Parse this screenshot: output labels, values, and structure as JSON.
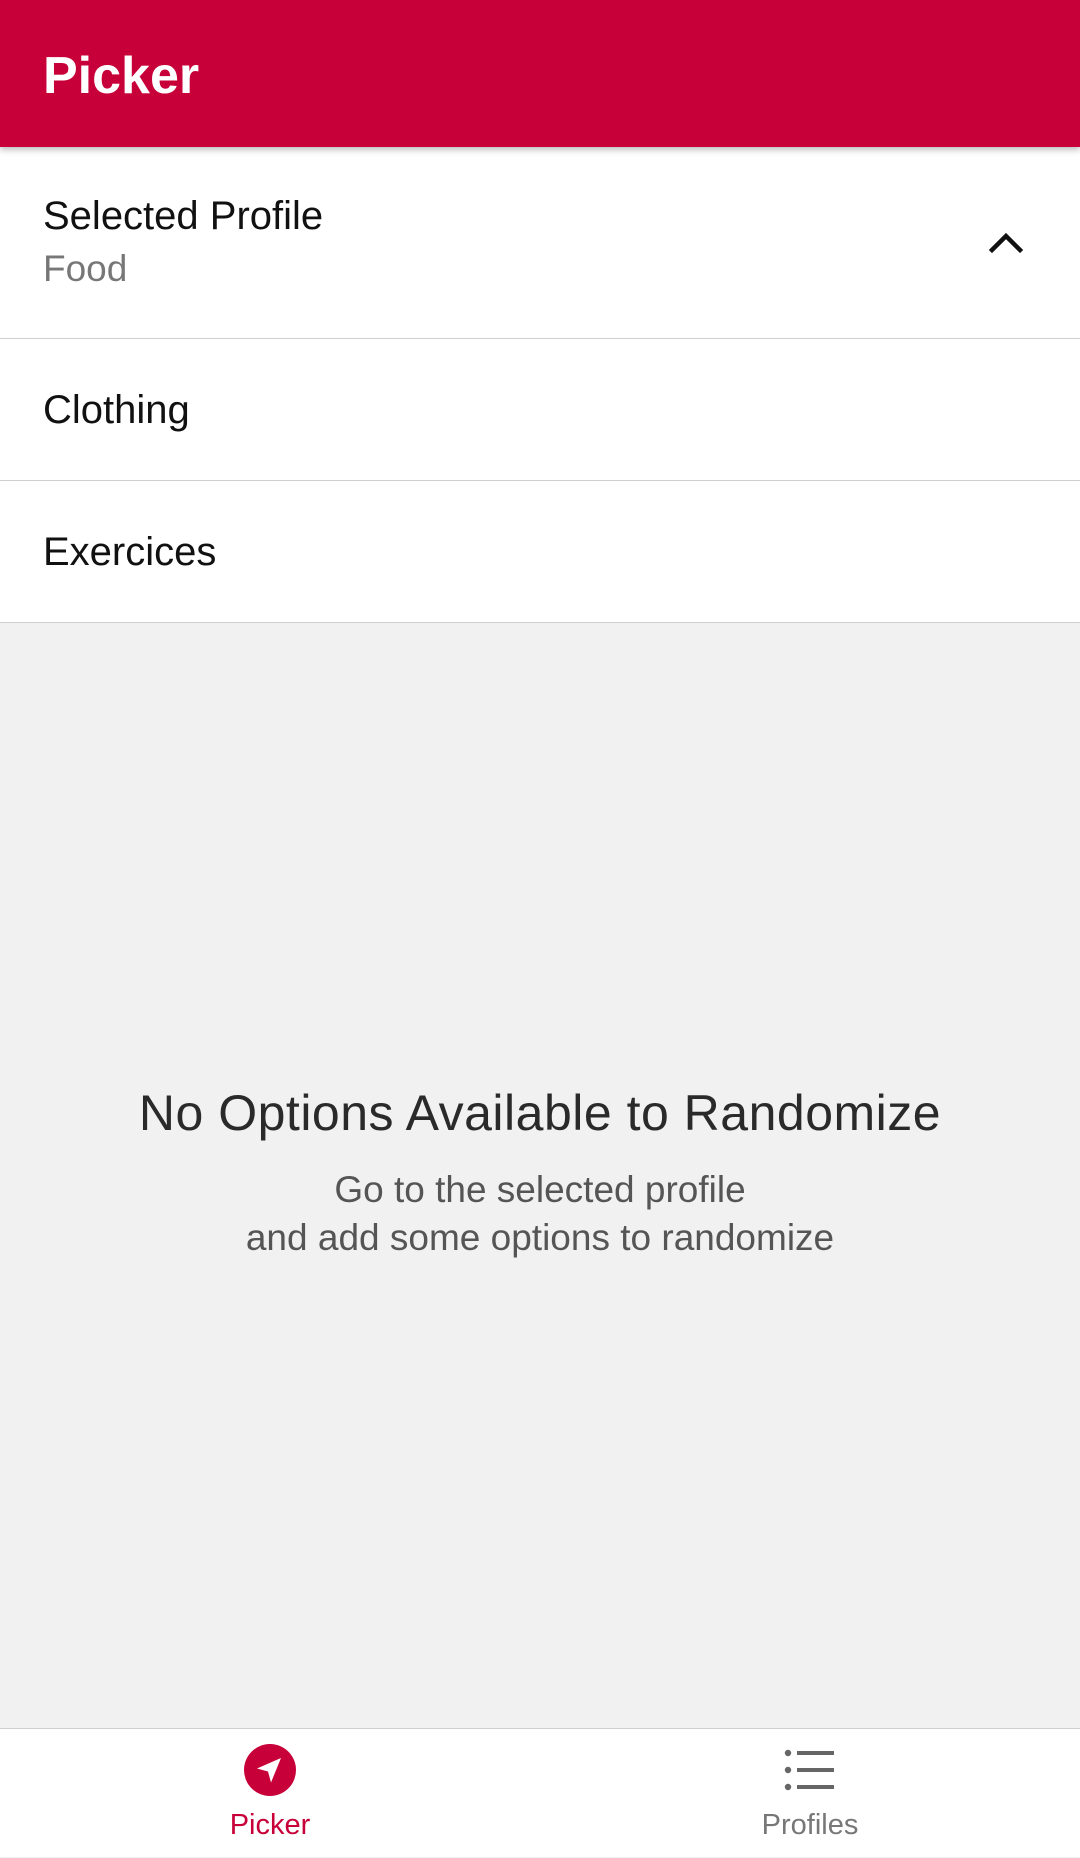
{
  "app_bar": {
    "title": "Picker",
    "color": "#c8003a"
  },
  "profile_selector": {
    "label": "Selected Profile",
    "value": "Food",
    "expanded": true,
    "toggle_icon": "chevron-up-icon",
    "options": [
      {
        "label": "Clothing"
      },
      {
        "label": "Exercices"
      }
    ]
  },
  "empty_state": {
    "title": "No Options Available to Randomize",
    "subtitle_line1": "Go to the selected profile",
    "subtitle_line2": "and add some options to randomize"
  },
  "bottom_nav": {
    "active": "Picker",
    "active_color": "#c8003a",
    "inactive_color": "#777777",
    "items": [
      {
        "label": "Picker",
        "icon": "navigation-arrow-icon"
      },
      {
        "label": "Profiles",
        "icon": "list-icon"
      }
    ]
  }
}
